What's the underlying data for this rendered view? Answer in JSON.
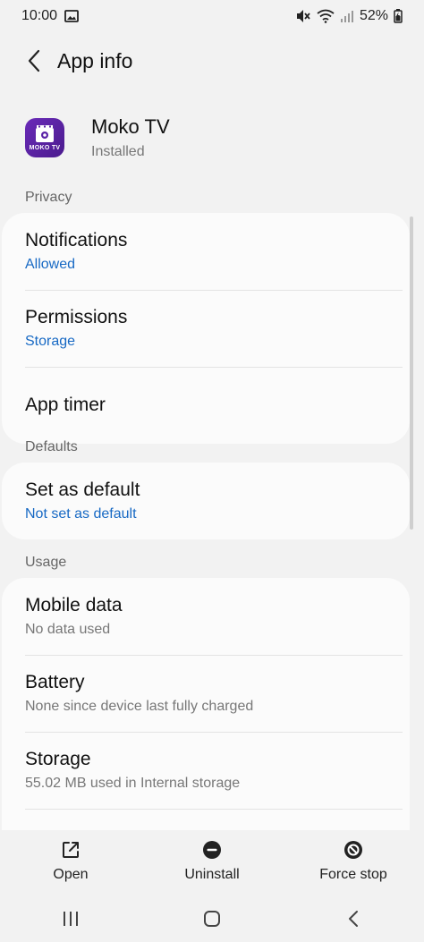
{
  "status_bar": {
    "time": "10:00",
    "battery": "52%"
  },
  "header": {
    "title": "App info"
  },
  "app": {
    "name": "Moko TV",
    "status": "Installed",
    "logo_text": "MOKO TV",
    "icon_color": "#5a22a6"
  },
  "sections": {
    "privacy": {
      "label": "Privacy",
      "items": [
        {
          "title": "Notifications",
          "subtitle": "Allowed"
        },
        {
          "title": "Permissions",
          "subtitle": "Storage"
        },
        {
          "title": "App timer",
          "subtitle": ""
        }
      ]
    },
    "defaults": {
      "label": "Defaults",
      "items": [
        {
          "title": "Set as default",
          "subtitle": "Not set as default"
        }
      ]
    },
    "usage": {
      "label": "Usage",
      "items": [
        {
          "title": "Mobile data",
          "subtitle": "No data used"
        },
        {
          "title": "Battery",
          "subtitle": "None since device last fully charged"
        },
        {
          "title": "Storage",
          "subtitle": "55.02 MB used in Internal storage"
        }
      ]
    }
  },
  "actions": {
    "open": "Open",
    "uninstall": "Uninstall",
    "force_stop": "Force stop"
  },
  "colors": {
    "link_blue": "#1769c4",
    "background": "#f2f2f2",
    "card": "#fbfbfb"
  }
}
